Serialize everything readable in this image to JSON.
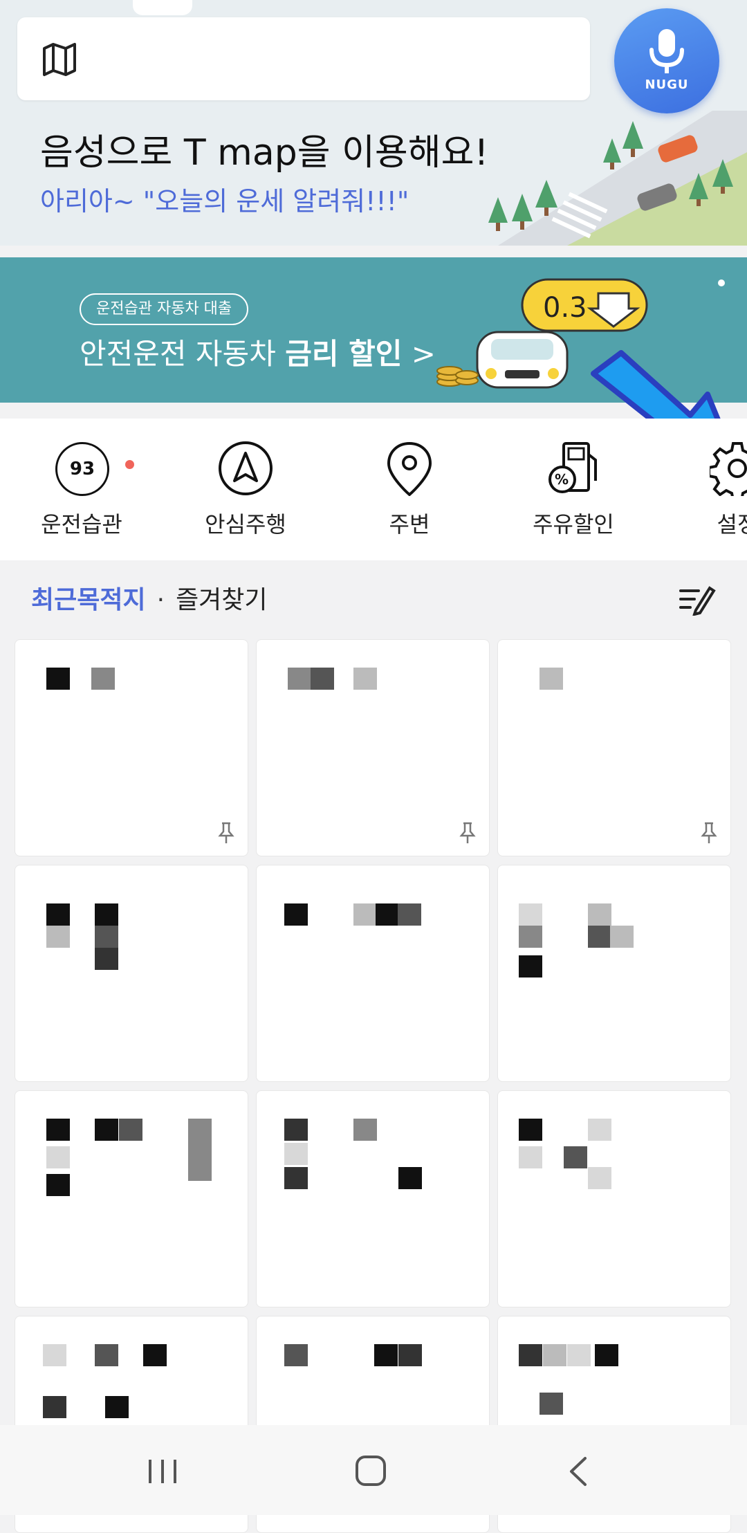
{
  "hero": {
    "title": "음성으로 T map을 이용해요!",
    "subtitle": "아리아~ \"오늘의 운세 알려줘!!!\"",
    "nugu_label": "NUGU"
  },
  "banner": {
    "tag": "운전습관 자동차 대출",
    "text_regular": "안전운전 자동차 ",
    "text_bold": "금리 할인",
    "chevron": " >",
    "badge_value": "0.3"
  },
  "menu": {
    "items": [
      {
        "label": "운전습관",
        "icon": "driving-score-icon",
        "score": "93"
      },
      {
        "label": "안심주행",
        "icon": "navigation-arrow-icon"
      },
      {
        "label": "주변",
        "icon": "location-pin-icon"
      },
      {
        "label": "주유할인",
        "icon": "fuel-discount-icon"
      },
      {
        "label": "설정",
        "icon": "gear-icon"
      }
    ]
  },
  "section": {
    "tab_recent": "최근목적지",
    "separator": "·",
    "tab_favorites": "즐겨찾기"
  },
  "colors": {
    "accent": "#4e6bd8",
    "banner": "#52a2ab",
    "nugu": "#4a82ea",
    "arrow": "#1e9cf0"
  },
  "navbar": {
    "buttons": [
      "recent-apps-icon",
      "home-icon",
      "back-icon"
    ]
  }
}
